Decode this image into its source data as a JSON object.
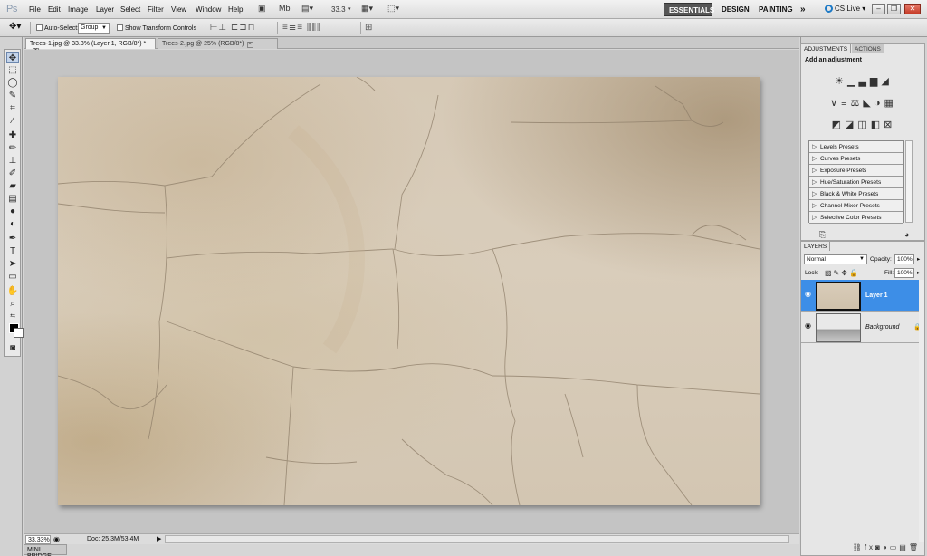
{
  "app": {
    "logo": "Ps"
  },
  "menu": [
    "File",
    "Edit",
    "Image",
    "Layer",
    "Select",
    "Filter",
    "View",
    "Window",
    "Help"
  ],
  "menubar": {
    "zoom_value": "33.3",
    "workspaces": [
      "ESSENTIALS",
      "DESIGN",
      "PAINTING"
    ],
    "more": "»",
    "cslive": "CS Live"
  },
  "options_bar": {
    "auto_select_label": "Auto-Select:",
    "auto_select_value": "Group",
    "show_transform_label": "Show Transform Controls"
  },
  "tabs": [
    {
      "label": "Trees-1.jpg @ 33.3% (Layer 1, RGB/8*) *",
      "active": true
    },
    {
      "label": "Trees-2.jpg @ 25% (RGB/8*)",
      "active": false
    }
  ],
  "status_bar": {
    "zoom": "33.33%",
    "doc": "Doc: 25.3M/53.4M"
  },
  "mini_bridge": "MINI BRIDGE",
  "adjustments_panel": {
    "tabs": [
      "ADJUSTMENTS",
      "ACTIONS"
    ],
    "title": "Add an adjustment",
    "presets": [
      "Levels Presets",
      "Curves Presets",
      "Exposure Presets",
      "Hue/Saturation Presets",
      "Black & White Presets",
      "Channel Mixer Presets",
      "Selective Color Presets"
    ]
  },
  "layers_panel": {
    "tab": "LAYERS",
    "blend_mode": "Normal",
    "opacity_label": "Opacity:",
    "opacity_value": "100%",
    "lock_label": "Lock:",
    "fill_label": "Fill:",
    "fill_value": "100%",
    "layers": [
      {
        "name": "Layer 1",
        "selected": true
      },
      {
        "name": "Background",
        "locked": true
      }
    ]
  },
  "colors": {
    "selection_blue": "#3d8ee7",
    "workspace_active": "#555555",
    "canvas_bg": "#c4c4c4"
  }
}
